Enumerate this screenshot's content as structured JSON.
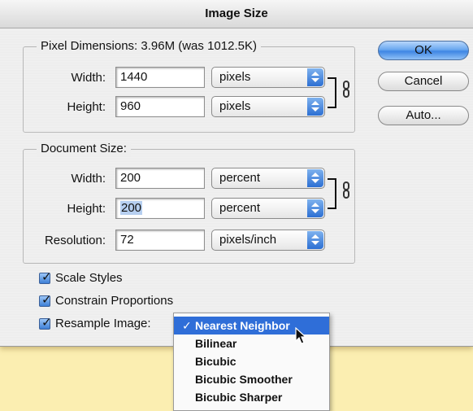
{
  "title": "Image Size",
  "pixel_dimensions": {
    "legend": "Pixel Dimensions:  3.96M (was 1012.5K)",
    "width": {
      "label": "Width:",
      "value": "1440",
      "unit": "pixels"
    },
    "height": {
      "label": "Height:",
      "value": "960",
      "unit": "pixels"
    }
  },
  "document_size": {
    "legend": "Document Size:",
    "width": {
      "label": "Width:",
      "value": "200",
      "unit": "percent"
    },
    "height": {
      "label": "Height:",
      "value": "200",
      "unit": "percent"
    },
    "resolution": {
      "label": "Resolution:",
      "value": "72",
      "unit": "pixels/inch"
    }
  },
  "buttons": {
    "ok": "OK",
    "cancel": "Cancel",
    "auto": "Auto..."
  },
  "checkboxes": {
    "scale_styles": {
      "label": "Scale Styles",
      "checked": true
    },
    "constrain_proportions": {
      "label": "Constrain Proportions",
      "checked": true
    },
    "resample_image": {
      "label": "Resample Image:",
      "checked": true
    }
  },
  "resample_menu": {
    "selected": "Nearest Neighbor",
    "check_mark": "✓",
    "options": [
      "Nearest Neighbor",
      "Bilinear",
      "Bicubic",
      "Bicubic Smoother",
      "Bicubic Sharper"
    ]
  },
  "colors": {
    "background": "#fbeeb1",
    "accent": "#2f6ed8",
    "dialog": "#eeeeee"
  }
}
